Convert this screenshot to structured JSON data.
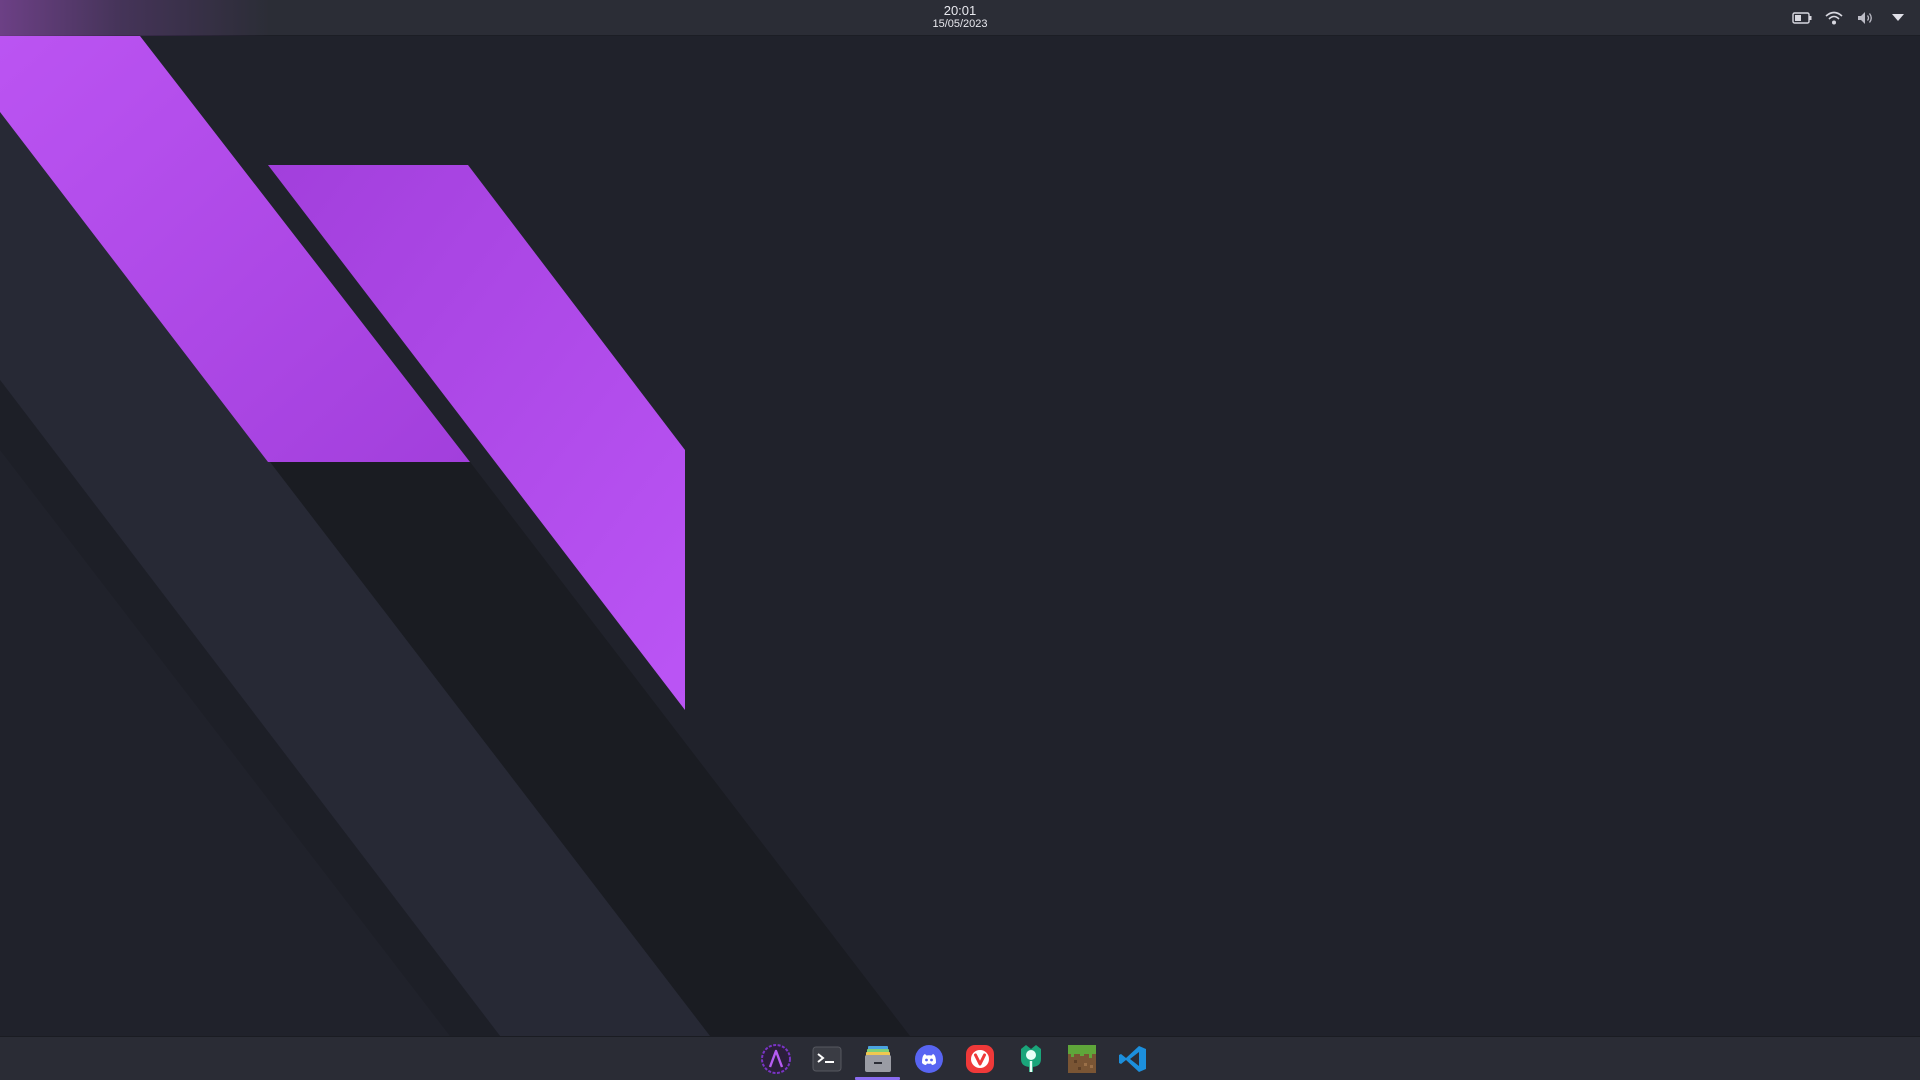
{
  "topbar": {
    "time": "20:01",
    "date": "15/05/2023",
    "tray_icons": [
      "battery-icon",
      "wifi-icon",
      "volume-icon",
      "tray-menu-chevron-icon"
    ]
  },
  "dock": {
    "apps": [
      {
        "name": "app-launcher",
        "icon": "arch-launcher-icon",
        "active": false
      },
      {
        "name": "terminal",
        "icon": "terminal-icon",
        "active": false
      },
      {
        "name": "file-manager",
        "icon": "files-icon",
        "active": true
      },
      {
        "name": "discord",
        "icon": "discord-icon",
        "active": false
      },
      {
        "name": "vivaldi",
        "icon": "vivaldi-icon",
        "active": false
      },
      {
        "name": "app-store",
        "icon": "store-icon",
        "active": false
      },
      {
        "name": "minecraft",
        "icon": "minecraft-grass-block-icon",
        "active": false
      },
      {
        "name": "vscode",
        "icon": "vscode-icon",
        "active": false
      }
    ]
  },
  "colors": {
    "desktop_bg": "#20222b",
    "accent_purple": "#b04ee8",
    "panel_bg": "#2b2d36"
  }
}
